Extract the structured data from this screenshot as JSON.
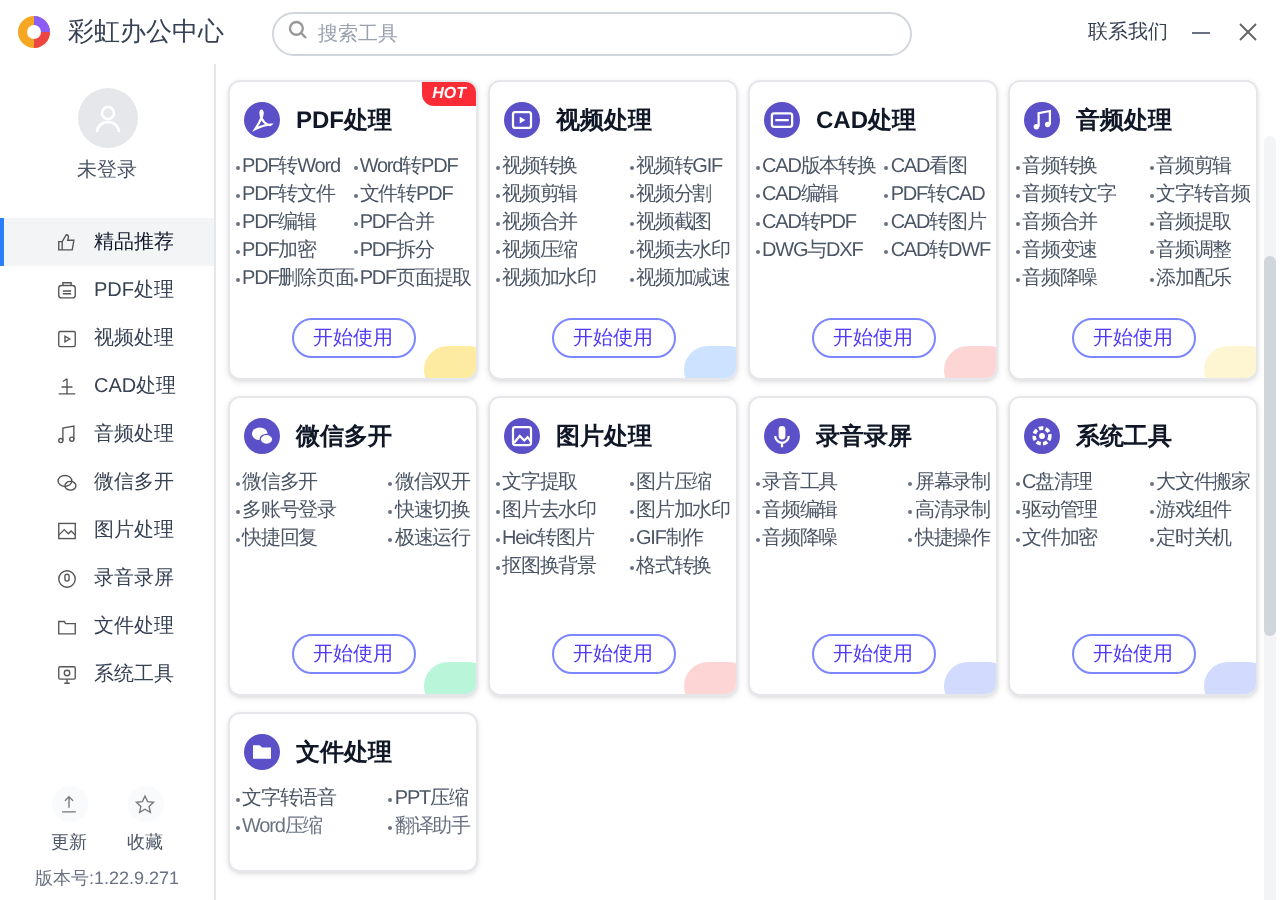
{
  "app": {
    "title": "彩虹办公中心"
  },
  "search": {
    "placeholder": "搜索工具"
  },
  "header": {
    "contact": "联系我们"
  },
  "user": {
    "name": "未登录"
  },
  "sidebar": {
    "items": [
      {
        "kind": "recommend",
        "label": "精品推荐",
        "selected": true
      },
      {
        "kind": "pdf",
        "label": "PDF处理",
        "selected": false
      },
      {
        "kind": "video",
        "label": "视频处理",
        "selected": false
      },
      {
        "kind": "cad",
        "label": "CAD处理",
        "selected": false
      },
      {
        "kind": "audio",
        "label": "音频处理",
        "selected": false
      },
      {
        "kind": "wechat",
        "label": "微信多开",
        "selected": false
      },
      {
        "kind": "image",
        "label": "图片处理",
        "selected": false
      },
      {
        "kind": "record",
        "label": "录音录屏",
        "selected": false
      },
      {
        "kind": "file",
        "label": "文件处理",
        "selected": false
      },
      {
        "kind": "system",
        "label": "系统工具",
        "selected": false
      }
    ],
    "footer": [
      {
        "kind": "update",
        "label": "更新"
      },
      {
        "kind": "favorite",
        "label": "收藏"
      }
    ],
    "version": "版本号:1.22.9.271"
  },
  "cards": [
    {
      "kind": "pdf",
      "title": "PDF处理",
      "badge": "HOT",
      "items": [
        "PDF转Word",
        "Word转PDF",
        "PDF转文件",
        "文件转PDF",
        "PDF编辑",
        "PDF合并",
        "PDF加密",
        "PDF拆分",
        "PDF删除页面",
        "PDF页面提取"
      ],
      "button": "开始使用"
    },
    {
      "kind": "video",
      "title": "视频处理",
      "items": [
        "视频转换",
        "视频转GIF",
        "视频剪辑",
        "视频分割",
        "视频合并",
        "视频截图",
        "视频压缩",
        "视频去水印",
        "视频加水印",
        "视频加减速"
      ],
      "button": "开始使用"
    },
    {
      "kind": "cad",
      "title": "CAD处理",
      "items": [
        "CAD版本转换",
        "CAD看图",
        "CAD编辑",
        "PDF转CAD",
        "CAD转PDF",
        "CAD转图片",
        "DWG与DXF",
        "CAD转DWF"
      ],
      "button": "开始使用"
    },
    {
      "kind": "audio",
      "title": "音频处理",
      "items": [
        "音频转换",
        "音频剪辑",
        "音频转文字",
        "文字转音频",
        "音频合并",
        "音频提取",
        "音频变速",
        "音频调整",
        "音频降噪",
        "添加配乐"
      ],
      "button": "开始使用"
    },
    {
      "kind": "wechat",
      "title": "微信多开",
      "items": [
        "微信多开",
        "微信双开",
        "多账号登录",
        "快速切换",
        "快捷回复",
        "极速运行"
      ],
      "button": "开始使用"
    },
    {
      "kind": "image",
      "title": "图片处理",
      "items": [
        "文字提取",
        "图片压缩",
        "图片去水印",
        "图片加水印",
        "Heic转图片",
        "GIF制作",
        "抠图换背景",
        "格式转换"
      ],
      "button": "开始使用"
    },
    {
      "kind": "record",
      "title": "录音录屏",
      "items": [
        "录音工具",
        "屏幕录制",
        "音频编辑",
        "高清录制",
        "音频降噪",
        "快捷操作"
      ],
      "button": "开始使用"
    },
    {
      "kind": "system",
      "title": "系统工具",
      "items": [
        "C盘清理",
        "大文件搬家",
        "驱动管理",
        "游戏组件",
        "文件加密",
        "定时关机"
      ],
      "button": "开始使用"
    },
    {
      "kind": "file",
      "title": "文件处理",
      "items": [
        "文字转语音",
        "PPT压缩",
        "Word压缩",
        "翻译助手"
      ]
    }
  ]
}
